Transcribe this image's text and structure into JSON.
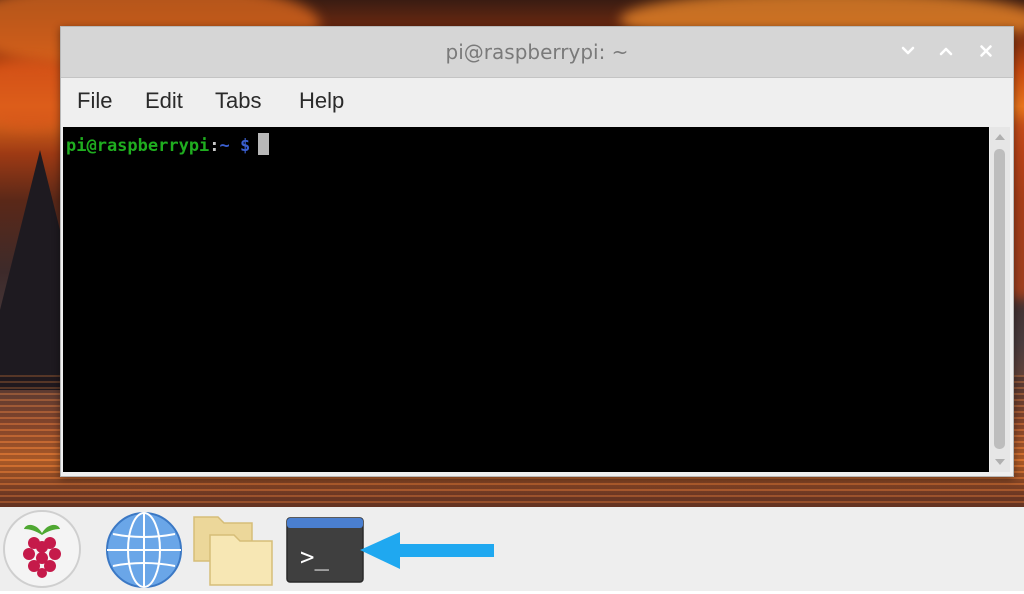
{
  "window": {
    "title": "pi@raspberrypi: ~",
    "buttons": {
      "minimize_icon": "chevron-down-icon",
      "maximize_icon": "chevron-up-icon",
      "close_icon": "close-icon"
    }
  },
  "menu": {
    "items": [
      {
        "label": "File"
      },
      {
        "label": "Edit"
      },
      {
        "label": "Tabs"
      },
      {
        "label": "Help"
      }
    ]
  },
  "terminal": {
    "user_host": "pi@raspberrypi",
    "colon": ":",
    "path": "~",
    "dollar": "$"
  },
  "taskbar": {
    "apps": [
      {
        "name": "raspberry-menu-icon"
      },
      {
        "name": "web-browser-icon"
      },
      {
        "name": "file-manager-icon"
      },
      {
        "name": "terminal-icon",
        "glyph": ">_"
      }
    ]
  },
  "colors": {
    "prompt_user": "#1fad1f",
    "prompt_path": "#3a5fcf",
    "annotation_arrow": "#1fa8f0",
    "terminal_bg": "#000000"
  }
}
